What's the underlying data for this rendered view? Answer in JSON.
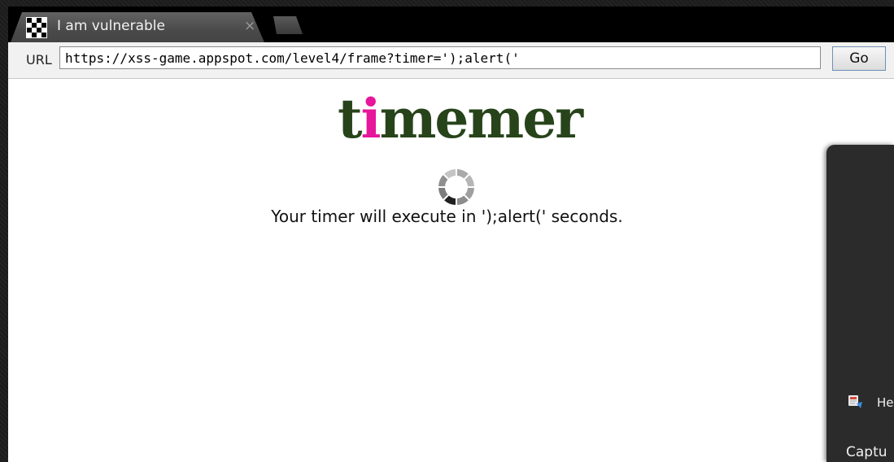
{
  "browser": {
    "tab_title": "I am vulnerable",
    "tab_close_symbol": "×",
    "favicon": "checkerboard-icon",
    "url_label": "URL",
    "url_value": "https://xss-game.appspot.com/level4/frame?timer=');alert('",
    "go_label": "Go"
  },
  "page": {
    "logo_prefix": "t",
    "logo_accent": "i",
    "logo_suffix": "memer",
    "logo_color": "#27431a",
    "logo_accent_color": "#e6179b",
    "spinner_icon": "loading-spinner-icon",
    "timer_message": "Your timer will execute in ');alert(' seconds."
  },
  "side_panel": {
    "item_1_icon": "app-icon",
    "item_1_label": "He",
    "item_2_label": "Captu"
  }
}
